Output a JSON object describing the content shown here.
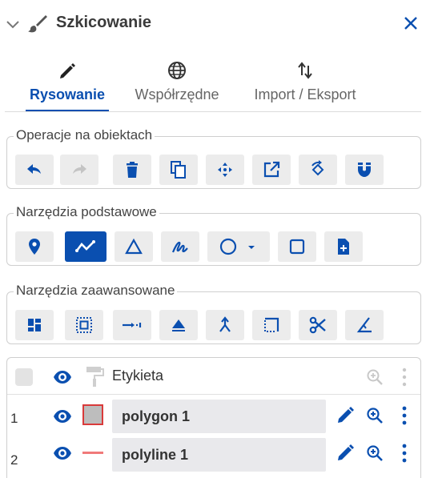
{
  "header": {
    "title": "Szkicowanie",
    "collapse_icon": "chevron-down-icon",
    "title_icon": "brush-icon",
    "close_icon": "close-icon",
    "accent_color": "#0a4fb0"
  },
  "tabs": [
    {
      "label": "Rysowanie",
      "icon": "pencil-icon",
      "active": true
    },
    {
      "label": "Współrzędne",
      "icon": "globe-icon",
      "active": false
    },
    {
      "label": "Import / Eksport",
      "icon": "import-export-icon",
      "active": false
    }
  ],
  "groups": {
    "object_operations": {
      "title": "Operacje na obiektach",
      "tools": [
        "undo-icon",
        "redo-icon",
        "delete-icon",
        "copy-icon",
        "move-icon",
        "open-external-icon",
        "rotate-icon",
        "snap-magnet-icon"
      ],
      "disabled": [
        "redo-icon"
      ]
    },
    "basic_tools": {
      "title": "Narzędzia podstawowe",
      "tools": [
        "point-marker-icon",
        "polyline-icon",
        "polygon-icon",
        "freehand-icon",
        "circle-icon",
        "rectangle-icon",
        "add-file-icon"
      ],
      "active": "polyline-icon"
    },
    "advanced_tools": {
      "title": "Narzędzia zaawansowane",
      "tools": [
        "split-layout-icon",
        "select-area-icon",
        "extend-line-icon",
        "flip-triangle-icon",
        "merge-icon",
        "dashed-corner-icon",
        "scissors-icon",
        "angle-icon"
      ]
    }
  },
  "table": {
    "header": {
      "label": "Etykieta",
      "visibility_icon": "eye-icon",
      "style_icon": "paint-roller-icon",
      "zoom_icon": "zoom-in-icon",
      "menu_icon": "more-vert-icon"
    },
    "rows": [
      {
        "index": "1",
        "name": "polygon 1",
        "symbol": "polygon-swatch",
        "fill": "#bdbdbd",
        "stroke": "#d93a3a"
      },
      {
        "index": "2",
        "name": "polyline 1",
        "symbol": "line-swatch",
        "stroke": "#f07a7a"
      }
    ]
  }
}
